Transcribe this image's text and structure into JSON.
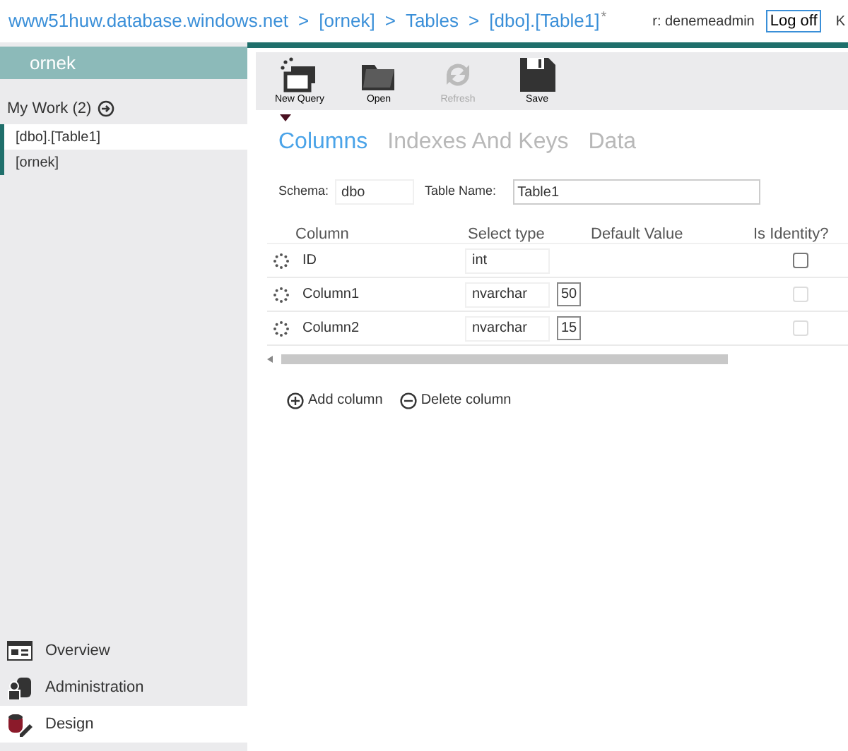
{
  "breadcrumb": [
    {
      "label": "www51huw.database.windows.net"
    },
    {
      "label": "[ornek]"
    },
    {
      "label": "Tables"
    },
    {
      "label": "[dbo].[Table1]",
      "modified": "*"
    }
  ],
  "separator": ">",
  "user": "r: denemeadmin",
  "logoff": "Log off",
  "edge_text": "K",
  "sidebar": {
    "title": "ornek",
    "my_work": "My Work (2)",
    "items": [
      {
        "label": "[dbo].[Table1]",
        "selected": true
      },
      {
        "label": "[ornek]",
        "selected": false
      }
    ],
    "nav": [
      {
        "kind": "overview",
        "label": "Overview",
        "selected": false
      },
      {
        "kind": "admin",
        "label": "Administration",
        "selected": false
      },
      {
        "kind": "design",
        "label": "Design",
        "selected": true
      }
    ]
  },
  "toolbar": [
    {
      "kind": "newquery",
      "label": "New Query",
      "disabled": false
    },
    {
      "kind": "open",
      "label": "Open",
      "disabled": false
    },
    {
      "kind": "refresh",
      "label": "Refresh",
      "disabled": true
    },
    {
      "kind": "save",
      "label": "Save",
      "disabled": false
    }
  ],
  "tabs": [
    {
      "label": "Columns",
      "selected": true
    },
    {
      "label": "Indexes And Keys",
      "selected": false
    },
    {
      "label": "Data",
      "selected": false
    }
  ],
  "schema": {
    "label": "Schema:",
    "value": "dbo"
  },
  "table_name": {
    "label": "Table Name:",
    "value": "Table1"
  },
  "table": {
    "columns": [
      "Column",
      "Select type",
      "Default Value",
      "Is Identity?"
    ],
    "rows": [
      {
        "name": "ID",
        "type": "int",
        "length": null,
        "identity": false,
        "disabled": false
      },
      {
        "name": "Column1",
        "type": "nvarchar",
        "length": "50",
        "identity": false,
        "disabled": true
      },
      {
        "name": "Column2",
        "type": "nvarchar",
        "length": "15",
        "identity": false,
        "disabled": true
      }
    ]
  },
  "actions": [
    {
      "kind": "add",
      "label": "Add column"
    },
    {
      "kind": "delete",
      "label": "Delete column"
    }
  ]
}
